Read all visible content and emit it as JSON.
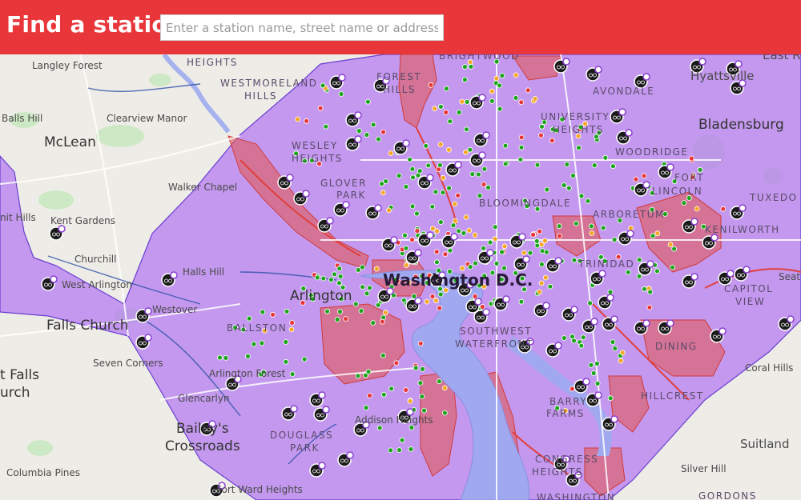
{
  "header": {
    "title": "Find a station",
    "search_placeholder": "Enter a station name, street name or address."
  },
  "colors": {
    "header_bg": "#e8363a",
    "service_area": "#b47cf0",
    "no_parking_zone": "#e05a5a",
    "water": "#a0a8f0",
    "station_available": "#1ea51e",
    "station_low": "#f5a623",
    "station_empty": "#e8363a",
    "bike_cluster_marker": "#1a1a1a",
    "bike_cluster_badge": "#8a3fd1"
  },
  "map": {
    "labels": [
      {
        "text": "Langley Forest",
        "size": "sm"
      },
      {
        "text": "HEIGHTS",
        "size": "caps"
      },
      {
        "text": "WESTMORELAND",
        "size": "caps"
      },
      {
        "text": "HILLS",
        "size": "caps"
      },
      {
        "text": "Balls Hill",
        "size": "sm"
      },
      {
        "text": "Clearview Manor",
        "size": "sm"
      },
      {
        "text": "McLean",
        "size": "lg"
      },
      {
        "text": "Walker Chapel",
        "size": "sm"
      },
      {
        "text": "Kent Gardens",
        "size": "sm"
      },
      {
        "text": "nit Hills",
        "size": "sm"
      },
      {
        "text": "Churchill",
        "size": "sm"
      },
      {
        "text": "Halls Hill",
        "size": "sm"
      },
      {
        "text": "West Arlington",
        "size": "sm"
      },
      {
        "text": "Westover",
        "size": "sm"
      },
      {
        "text": "Falls Church",
        "size": "lg"
      },
      {
        "text": "Arlington",
        "size": "lg"
      },
      {
        "text": "BALLSTON",
        "size": "caps"
      },
      {
        "text": "Seven Corners",
        "size": "sm"
      },
      {
        "text": "t Falls",
        "size": "lg"
      },
      {
        "text": "urch",
        "size": "lg"
      },
      {
        "text": "Arlington Forest",
        "size": "sm"
      },
      {
        "text": "Glencarlyn",
        "size": "sm"
      },
      {
        "text": "Bailey's",
        "size": "lg"
      },
      {
        "text": "Crossroads",
        "size": "lg"
      },
      {
        "text": "Addison Heights",
        "size": "sm"
      },
      {
        "text": "DOUGLASS",
        "size": "caps"
      },
      {
        "text": "PARK",
        "size": "caps"
      },
      {
        "text": "Columbia Pines",
        "size": "sm"
      },
      {
        "text": "Fort Ward Heights",
        "size": "sm"
      },
      {
        "text": "FOREST",
        "size": "caps"
      },
      {
        "text": "HILLS",
        "size": "caps"
      },
      {
        "text": "BRIGHTWOOD",
        "size": "caps"
      },
      {
        "text": "WESLEY",
        "size": "caps"
      },
      {
        "text": "HEIGHTS",
        "size": "caps"
      },
      {
        "text": "GLOVER",
        "size": "caps"
      },
      {
        "text": "PARK",
        "size": "caps"
      },
      {
        "text": "UNIVERSITY",
        "size": "caps"
      },
      {
        "text": "HEIGHTS",
        "size": "caps"
      },
      {
        "text": "AVONDALE",
        "size": "caps"
      },
      {
        "text": "WOODRIDGE",
        "size": "caps"
      },
      {
        "text": "FORT",
        "size": "caps"
      },
      {
        "text": "LINCOLN",
        "size": "caps"
      },
      {
        "text": "BLOOMINGDALE",
        "size": "caps"
      },
      {
        "text": "ARBORETUM",
        "size": "caps"
      },
      {
        "text": "Washington D.C.",
        "size": "xl"
      },
      {
        "text": "SOUTHWEST",
        "size": "caps"
      },
      {
        "text": "WATERFRONT",
        "size": "caps"
      },
      {
        "text": "TRINIDAD",
        "size": "caps"
      },
      {
        "text": "KENILWORTH",
        "size": "caps"
      },
      {
        "text": "CAPITOL",
        "size": "caps"
      },
      {
        "text": "VIEW",
        "size": "caps"
      },
      {
        "text": "DINING",
        "size": "caps"
      },
      {
        "text": "HILLCREST",
        "size": "caps"
      },
      {
        "text": "BARRY",
        "size": "caps"
      },
      {
        "text": "FARMS",
        "size": "caps"
      },
      {
        "text": "CONGRESS",
        "size": "caps"
      },
      {
        "text": "HEIGHTS",
        "size": "caps"
      },
      {
        "text": "WASHINGTON",
        "size": "caps"
      },
      {
        "text": "Hyattsville",
        "size": "md"
      },
      {
        "text": "East R",
        "size": "md"
      },
      {
        "text": "Bladensburg",
        "size": "lg"
      },
      {
        "text": "TUXEDO",
        "size": "caps"
      },
      {
        "text": "Seat",
        "size": "sm"
      },
      {
        "text": "Coral Hills",
        "size": "sm"
      },
      {
        "text": "Suitland",
        "size": "md"
      },
      {
        "text": "Silver Hill",
        "size": "sm"
      },
      {
        "text": "GORDONS",
        "size": "caps"
      }
    ]
  }
}
